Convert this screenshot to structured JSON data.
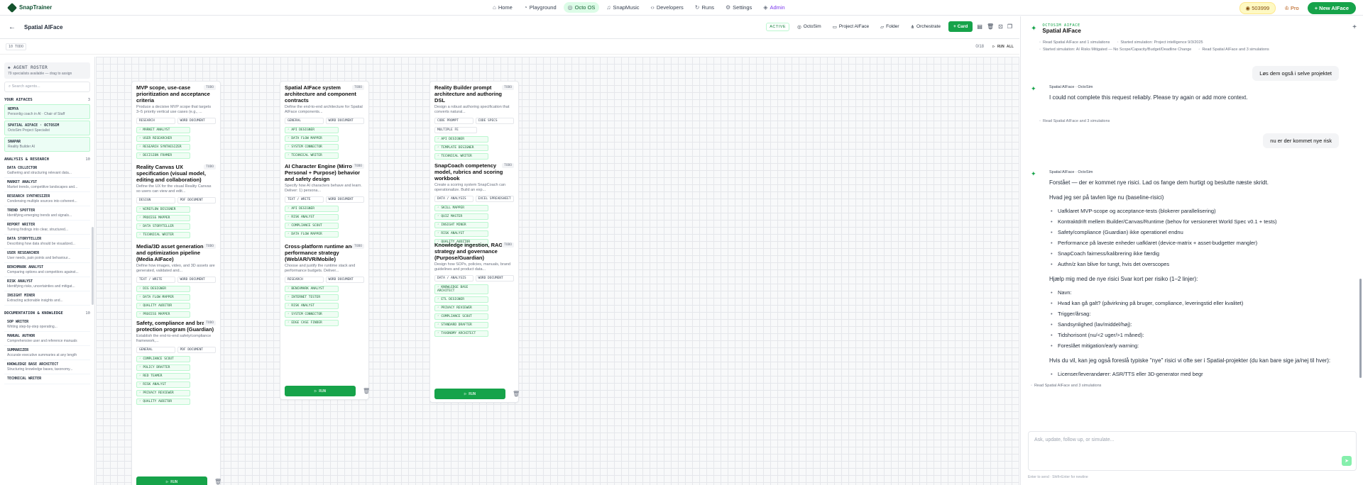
{
  "brand": {
    "name": "SnapTrainer"
  },
  "nav": [
    {
      "label": "Home",
      "icon": "home-icon",
      "glyph": "⌂"
    },
    {
      "label": "Playground",
      "icon": "playground-icon",
      "glyph": "◔"
    },
    {
      "label": "Octo OS",
      "icon": "octo-icon",
      "glyph": "◎"
    },
    {
      "label": "SnapMusic",
      "icon": "music-icon",
      "glyph": "♫"
    },
    {
      "label": "Developers",
      "icon": "code-icon",
      "glyph": "‹›"
    },
    {
      "label": "Runs",
      "icon": "runs-icon",
      "glyph": "↻"
    },
    {
      "label": "Settings",
      "icon": "gear-icon",
      "glyph": "⚙"
    },
    {
      "label": "Admin",
      "icon": "admin-icon",
      "glyph": "◈"
    }
  ],
  "top": {
    "credits": "503999",
    "pro": "Pro",
    "new_button": "New AIFace"
  },
  "subbar": {
    "title": "Spatial AIFace",
    "active": "ACTIVE",
    "octosim": "OctoSim",
    "project": "Project AIFace",
    "folder": "Folder",
    "orchestrate": "Orchestrate",
    "card": "Card"
  },
  "band": {
    "todo": "10 TODO",
    "count": "0/18",
    "run_all": "RUN ALL"
  },
  "sidebar": {
    "title": "AGENT ROSTER",
    "subtitle": "79 specialists available — drag to assign",
    "search_placeholder": "Search agents...",
    "sections": [
      {
        "name": "YOUR AIFACES",
        "count": "3",
        "agents": [
          {
            "name": "NEMYA",
            "desc": "Personlig coach in AI · Chair of Staff"
          },
          {
            "name": "SPATIAL AIFACE · OCTOSIM",
            "desc": "OctoSim Project Specialist"
          },
          {
            "name": "SNAPAR",
            "desc": "Reality Builder AI"
          }
        ]
      },
      {
        "name": "ANALYSIS & RESEARCH",
        "count": "10",
        "agents": [
          {
            "name": "DATA COLLECTOR",
            "desc": "Gathering and structuring relevant data..."
          },
          {
            "name": "MARKET ANALYST",
            "desc": "Market trends, competitive landscapes and..."
          },
          {
            "name": "RESEARCH SYNTHESIZER",
            "desc": "Condensing multiple sources into coherent..."
          },
          {
            "name": "TREND SPOTTER",
            "desc": "Identifying emerging trends and signals..."
          },
          {
            "name": "REPORT WRITER",
            "desc": "Turning findings into clear, structured..."
          },
          {
            "name": "DATA STORYTELLER",
            "desc": "Describing how data should be visualized..."
          },
          {
            "name": "USER RESEARCHER",
            "desc": "User needs, pain points and behaviour..."
          },
          {
            "name": "BENCHMARK ANALYST",
            "desc": "Comparing options and competitors against..."
          },
          {
            "name": "RISK ANALYST",
            "desc": "Identifying risks, uncertainties and mitigat..."
          },
          {
            "name": "INSIGHT MINER",
            "desc": "Extracting actionable insights and..."
          }
        ]
      },
      {
        "name": "DOCUMENTATION & KNOWLEDGE",
        "count": "10",
        "agents": [
          {
            "name": "SOP WRITER",
            "desc": "Writing step-by-step operating..."
          },
          {
            "name": "MANUAL AUTHOR",
            "desc": "Comprehensive user and reference manuals"
          },
          {
            "name": "SUMMARIZER",
            "desc": "Accurate executive summaries at any length"
          },
          {
            "name": "KNOWLEDGE BASE ARCHITECT",
            "desc": "Structuring knowledge bases, taxonomy..."
          },
          {
            "name": "TECHNICAL WRITER",
            "desc": ""
          }
        ]
      }
    ]
  },
  "columns": [
    {
      "cards": [
        {
          "title": "MVP scope, use-case prioritization and acceptance criteria",
          "desc": "Produce a decisive MVP scope that targets 3–5 priority vertical use cases (e.g., ...",
          "sel1": "RESEARCH",
          "sel2": "WORD DOCUMENT",
          "tags": [
            "MARKET ANALYST",
            "USER RESEARCHER",
            "RESEARCH SYNTHESIZER",
            "DECISION FRAMER"
          ]
        },
        {
          "title": "Reality Canvas UX specification (visual model, editing and collaboration)",
          "desc": "Define the UX for the visual Reality Canvas so users can view and edit...",
          "sel1": "DESIGN",
          "sel2": "PDF DOCUMENT",
          "tags": [
            "WIREFLOW DESIGNER",
            "PROCESS MAPPER",
            "DATA STORYTELLER",
            "TECHNICAL WRITER"
          ]
        },
        {
          "title": "Media/3D asset generation and optimization pipeline (Media AIFace)",
          "desc": "Define how images, video, and 3D assets are generated, validated and...",
          "sel1": "TEXT / WRITE",
          "sel2": "WORD DOCUMENT",
          "tags": [
            "DIG DESIGNER",
            "DATA FLOW MAPPER",
            "QUALITY AUDITOR",
            "PROCESS MAPPER"
          ]
        },
        {
          "title": "Safety, compliance and brand protection program (Guardian)",
          "desc": "Establish the end-to-end safety/compliance framework,...",
          "sel1": "GENERAL",
          "sel2": "PDF DOCUMENT",
          "tags": [
            "COMPLIANCE SCOUT",
            "POLICY DRAFTER",
            "RED TEAMER",
            "RISK ANALYST",
            "PRIVACY REVIEWER",
            "QUALITY AUDITOR"
          ]
        }
      ],
      "run": "RUN"
    },
    {
      "cards": [
        {
          "title": "Spatial AIFace system architecture and component contracts",
          "desc": "Define the end-to-end architecture for Spatial AIFace components...",
          "sel1": "GENERAL",
          "sel2": "WORD DOCUMENT",
          "tags": [
            "API DESIGNER",
            "DATA FLOW MAPPER",
            "SYSTEM CONNECTOR",
            "TECHNICAL WRITER"
          ]
        },
        {
          "title": "AI Character Engine (Mirror + Personal + Purpose) behavior and safety design",
          "desc": "Specify how AI characters behave and learn. Deliver: 1) persona...",
          "sel1": "TEXT / WRITE",
          "sel2": "WORD DOCUMENT",
          "tags": [
            "API DESIGNER",
            "RISK ANALYST",
            "COMPLIANCE SCOUT",
            "DATA FLOW MAPPER"
          ]
        },
        {
          "title": "Cross-platform runtime and performance strategy (Web/AR/VR/Mobile)",
          "desc": "Choose and justify the runtime stack and performance budgets. Deliver...",
          "sel1": "RESEARCH",
          "sel2": "WORD DOCUMENT",
          "tags": [
            "BENCHMARK ANALYST",
            "INTERNET TESTER",
            "RISK ANALYST",
            "SYSTEM CONNECTOR",
            "EDGE CASE FINDER"
          ]
        }
      ],
      "run": "RUN"
    },
    {
      "cards": [
        {
          "title": "Reality Builder prompt architecture and authoring DSL",
          "desc": "Design a robust authoring specification that converts natural...",
          "sel1": "CODE PROMPT",
          "sel2": "CODE SPECS",
          "sel3": "MULTIPLE FE",
          "tags": [
            "API DESIGNER",
            "TEMPLATE DESIGNER",
            "TECHNICAL WRITER"
          ]
        },
        {
          "title": "SnapCoach competency model, rubrics and scoring workbook",
          "desc": "Create a scoring system SnapCoach can operationalize. Build an exp...",
          "sel1": "DATA / ANALYSIS",
          "sel2": "EXCEL SPREADSHEET",
          "tags": [
            "SKILL MAPPER",
            "QUIZ MASTER",
            "INSIGHT MINER",
            "RISK ANALYST",
            "QUALITY AUDITOR"
          ]
        },
        {
          "title": "Knowledge ingestion, RAG strategy and governance (Purpose/Guardian)",
          "desc": "Design how SOPs, policies, manuals, brand guidelines and product data...",
          "sel1": "DATA / ANALYSIS",
          "sel2": "WORD DOCUMENT",
          "tags": [
            "KNOWLEDGE BASE ARCHITECT",
            "ETL DESIGNER",
            "PRIVACY REVIEWER",
            "COMPLIANCE SCOUT",
            "STANDARD DRAFTER",
            "TAXONOMY ARCHITECT"
          ]
        }
      ],
      "run": "RUN"
    }
  ],
  "chat": {
    "header_sub": "OCTOSIM AIFACE",
    "header_title": "Spatial AIFace",
    "chips1": [
      "Read Spatial AIFace and 1 simulations",
      "Started simulation: Project intelligence 9/3/2025",
      "Started simulation: AI Risks Mitigated — No Scope/Capacity/Budget/Deadline Change",
      "Read Spatial AIFace and 3 simulations"
    ],
    "user1": "Løs dem også i selve projektet",
    "bot1_src": "Spatial AIFace · OctoSim",
    "bot1_text": "I could not complete this request reliably. Please try again or add more context.",
    "bot1_chip": "Read Spatial AIFace and 3 simulations",
    "user2": "nu er der kommet nye risk",
    "bot2_src": "Spatial AIFace · OctoSim",
    "bot2_p1": "Forstået — der er kommet nye risici. Lad os fange dem hurtigt og beslutte næste skridt.",
    "bot2_p2": "Hvad jeg ser på tavlen lige nu (baseline-risici)",
    "bot2_list1": [
      "Uafklaret MVP-scope og acceptance-tests (blokerer parallelisering)",
      "Kontraktdrift mellem Builder/Canvas/Runtime (behov for versioneret World Spec v0.1 + tests)",
      "Safety/compliance (Guardian) ikke operationel endnu",
      "Performance på laveste enheder uafklaret (device-matrix + asset-budgetter mangler)",
      "SnapCoach fairness/kalibrering ikke færdig",
      "Authn/z kan blive for tungt, hvis det overscopes"
    ],
    "bot2_p3": "Hjælp mig med de nye risici Svar kort per risiko (1–2 linjer):",
    "bot2_list2": [
      "Navn:",
      "Hvad kan gå galt? (påvirkning på bruger, compliance, leveringstid eller kvalitet)",
      "Trigger/årsag:",
      "Sandsynlighed (lav/middel/høj):",
      "Tidshorisont (nu/<2 uger/>1 måned):",
      "Foreslået mitigation/early warning:"
    ],
    "bot2_p4": "Hvis du vil, kan jeg også foreslå typiske \"nye\" risici vi ofte ser i Spatial-projekter (du kan bare sige ja/nej til hver):",
    "bot2_list3": [
      "Licenser/leverandører: ASR/TTS eller 3D-generator med begr"
    ],
    "bot2_chip": "Read Spatial AIFace and 3 simulations",
    "input_placeholder": "Ask, update, follow up, or simulate...",
    "hint": "Enter to send · Shift+Enter for newline"
  }
}
